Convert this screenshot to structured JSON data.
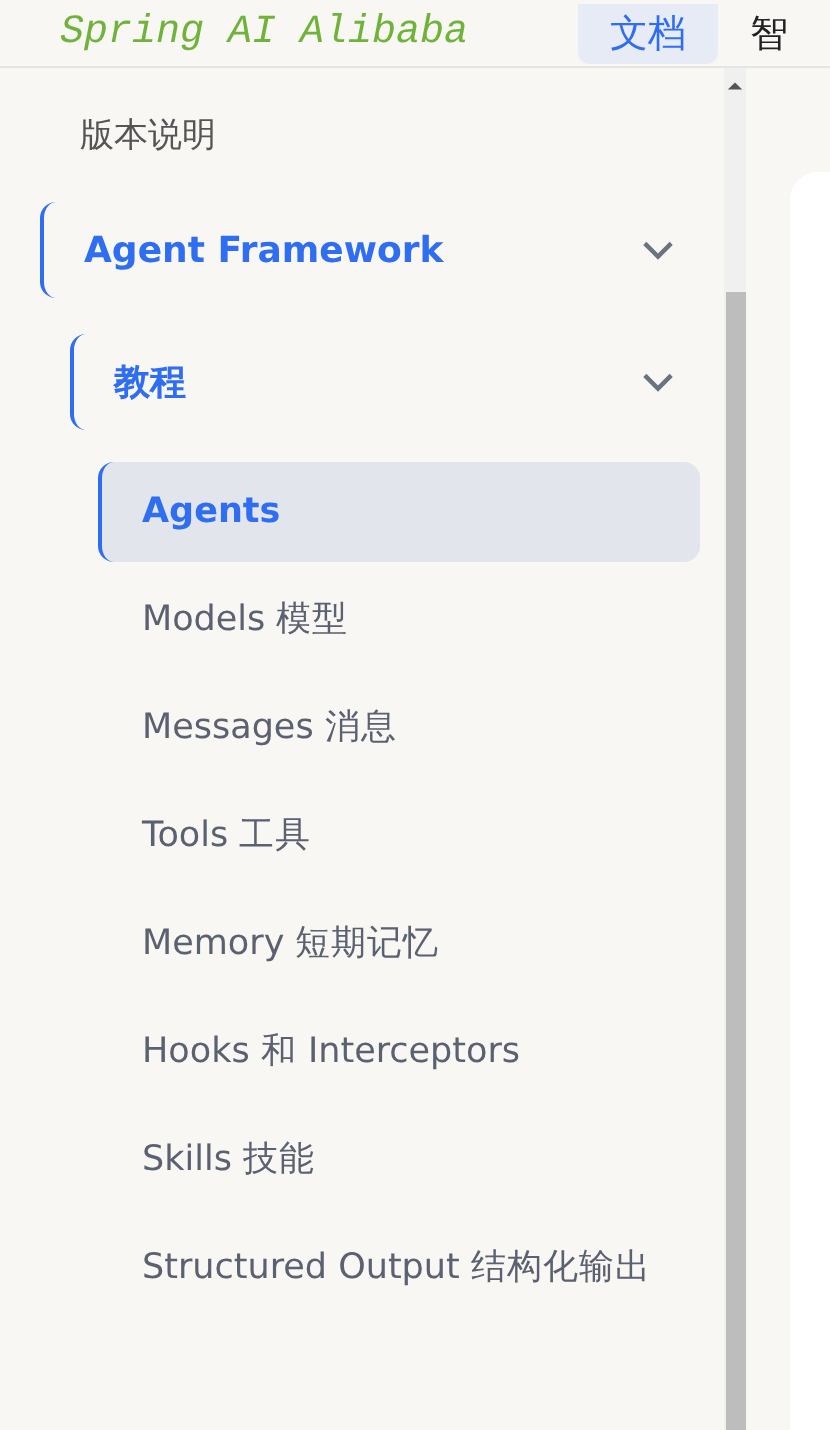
{
  "header": {
    "logo": "Spring AI Alibaba",
    "nav": [
      {
        "label": "文档",
        "selected": true
      },
      {
        "label": "智",
        "selected": false
      }
    ]
  },
  "sidebar": {
    "items": [
      {
        "label": "版本说明"
      },
      {
        "label": "Agent Framework",
        "expanded": true,
        "children": [
          {
            "label": "教程",
            "expanded": true,
            "children": [
              {
                "label": "Agents",
                "selected": true
              },
              {
                "label": "Models 模型",
                "selected": false
              },
              {
                "label": "Messages 消息",
                "selected": false
              },
              {
                "label": "Tools 工具",
                "selected": false
              },
              {
                "label": "Memory 短期记忆",
                "selected": false
              },
              {
                "label": "Hooks 和 Interceptors",
                "selected": false
              },
              {
                "label": "Skills 技能",
                "selected": false
              },
              {
                "label": "Structured Output 结构化输出",
                "selected": false
              }
            ]
          }
        ]
      }
    ]
  }
}
